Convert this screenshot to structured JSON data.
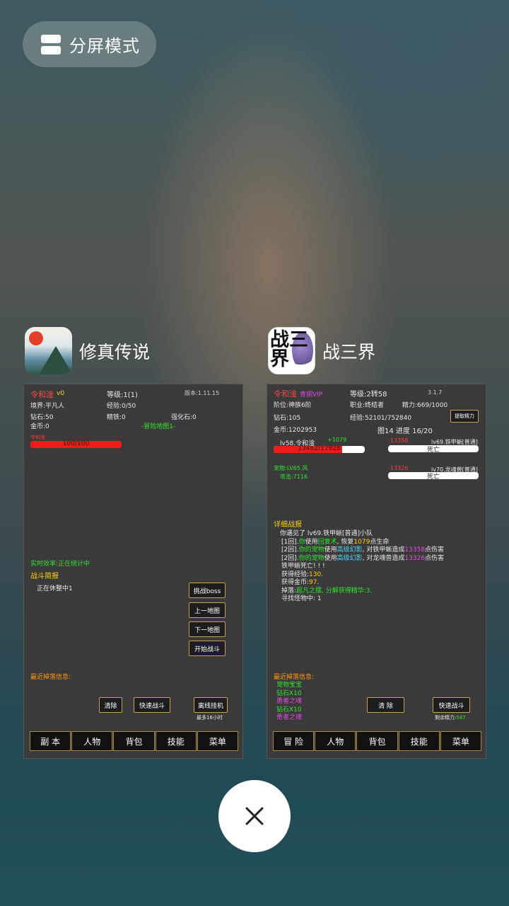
{
  "split_button": {
    "label": "分屏模式",
    "icon": "split-screen-icon"
  },
  "close_icon": "close-icon",
  "apps": [
    {
      "name": "修真传说",
      "icon_text": "修真传说",
      "screen": {
        "player": "令和淦",
        "player_suffix": "v0",
        "level": "等级:1(1)",
        "version": "版本:1.11.15",
        "realm": "境界:平凡人",
        "exp": "经验:0/50",
        "diamond": "钻石:50",
        "iron": "精铁:0",
        "stone": "强化石:0",
        "gold": "金币:0",
        "map": "-冒险地图1-",
        "hp_name": "令和淦",
        "hp_text": "100/100",
        "hp_fraction": 1.0,
        "efficiency": "实时效率:正在统计中",
        "brief_title": "战斗简报",
        "brief_text": "正在休整中1",
        "btn_boss": "挑战boss",
        "btn_prev": "上一地图",
        "btn_next": "下一地图",
        "btn_start": "开始战斗",
        "drop_title": "最近掉落信息:",
        "btn_clear": "清除",
        "btn_fast": "快速战斗",
        "btn_offline": "离线挂机",
        "offline_note": "最多16小时",
        "tabs": [
          "副 本",
          "人物",
          "背包",
          "技能",
          "菜单"
        ]
      }
    },
    {
      "name": "战三界",
      "icon_text": "战三界",
      "screen": {
        "player": "令和淦",
        "vip": "青铜VIP",
        "level": "等级:2转58",
        "version": "3.1.7",
        "rank": "阶位:神族6阶",
        "job": "职业:终结者",
        "energy": "精力:669/1000",
        "diamond": "钻石:105",
        "exp": "经验:52101/752840",
        "btn_energy": "提取精力",
        "gold": "金币:1202953",
        "map_progress": "图14  进度 16/20",
        "self_label": "lv58.令和淦",
        "self_heal": "+1079",
        "self_hp": "13462/17928",
        "self_hp_fraction": 0.75,
        "enemy1_dmg": "-13358",
        "enemy1_name": "lv69.铁甲蜥[普通]",
        "enemy1_state": "死亡",
        "pet_label": "宠物:LV65.风",
        "pet_attack": "攻击:7116",
        "enemy2_dmg": "-13326",
        "enemy2_name": "lv70.龙魂兽[普通]",
        "enemy2_state": "死亡",
        "detail_title": "详细战报",
        "log": {
          "l1": "你遇见了 lv69.铁甲蜥[普通]小队",
          "l2a": "[1回].",
          "l2b": "你",
          "l2c": "使用",
          "l2d": "回复术",
          "l2e": ", 恢复",
          "l2f": "1079",
          "l2g": "点生命",
          "l3a": "[2回].",
          "l3b": "你的宠物",
          "l3c": "使用",
          "l3d": "高级幻影",
          "l3e": ", 对铁甲蜥造成",
          "l3f": "13358",
          "l3g": "点伤害",
          "l4a": "[2回].",
          "l4b": "你的宠物",
          "l4c": "使用",
          "l4d": "高级幻影",
          "l4e": ", 对龙魂兽造成",
          "l4f": "13326",
          "l4g": "点伤害",
          "l5": "铁甲蜥死亡! ! !",
          "l6a": "获得经验:",
          "l6b": "130",
          "l6c": ".",
          "l7a": "获得金币:",
          "l7b": "97",
          "l7c": ".",
          "l8a": "掉落:",
          "l8b": "超凡之摆, 分解获得精华:3.",
          "l9": "寻找怪物中: 1"
        },
        "drop_title": "最近掉落信息:",
        "drops": [
          "宠物宝宝",
          "钻石X10",
          "勇者之魂",
          "钻石X10",
          "勇者之魂"
        ],
        "btn_clear": "清 除",
        "btn_fast": "快速战斗",
        "remaining_label": "剩余精力:",
        "remaining_value": "587",
        "tabs": [
          "冒 险",
          "人物",
          "背包",
          "技能",
          "菜单"
        ]
      }
    }
  ]
}
